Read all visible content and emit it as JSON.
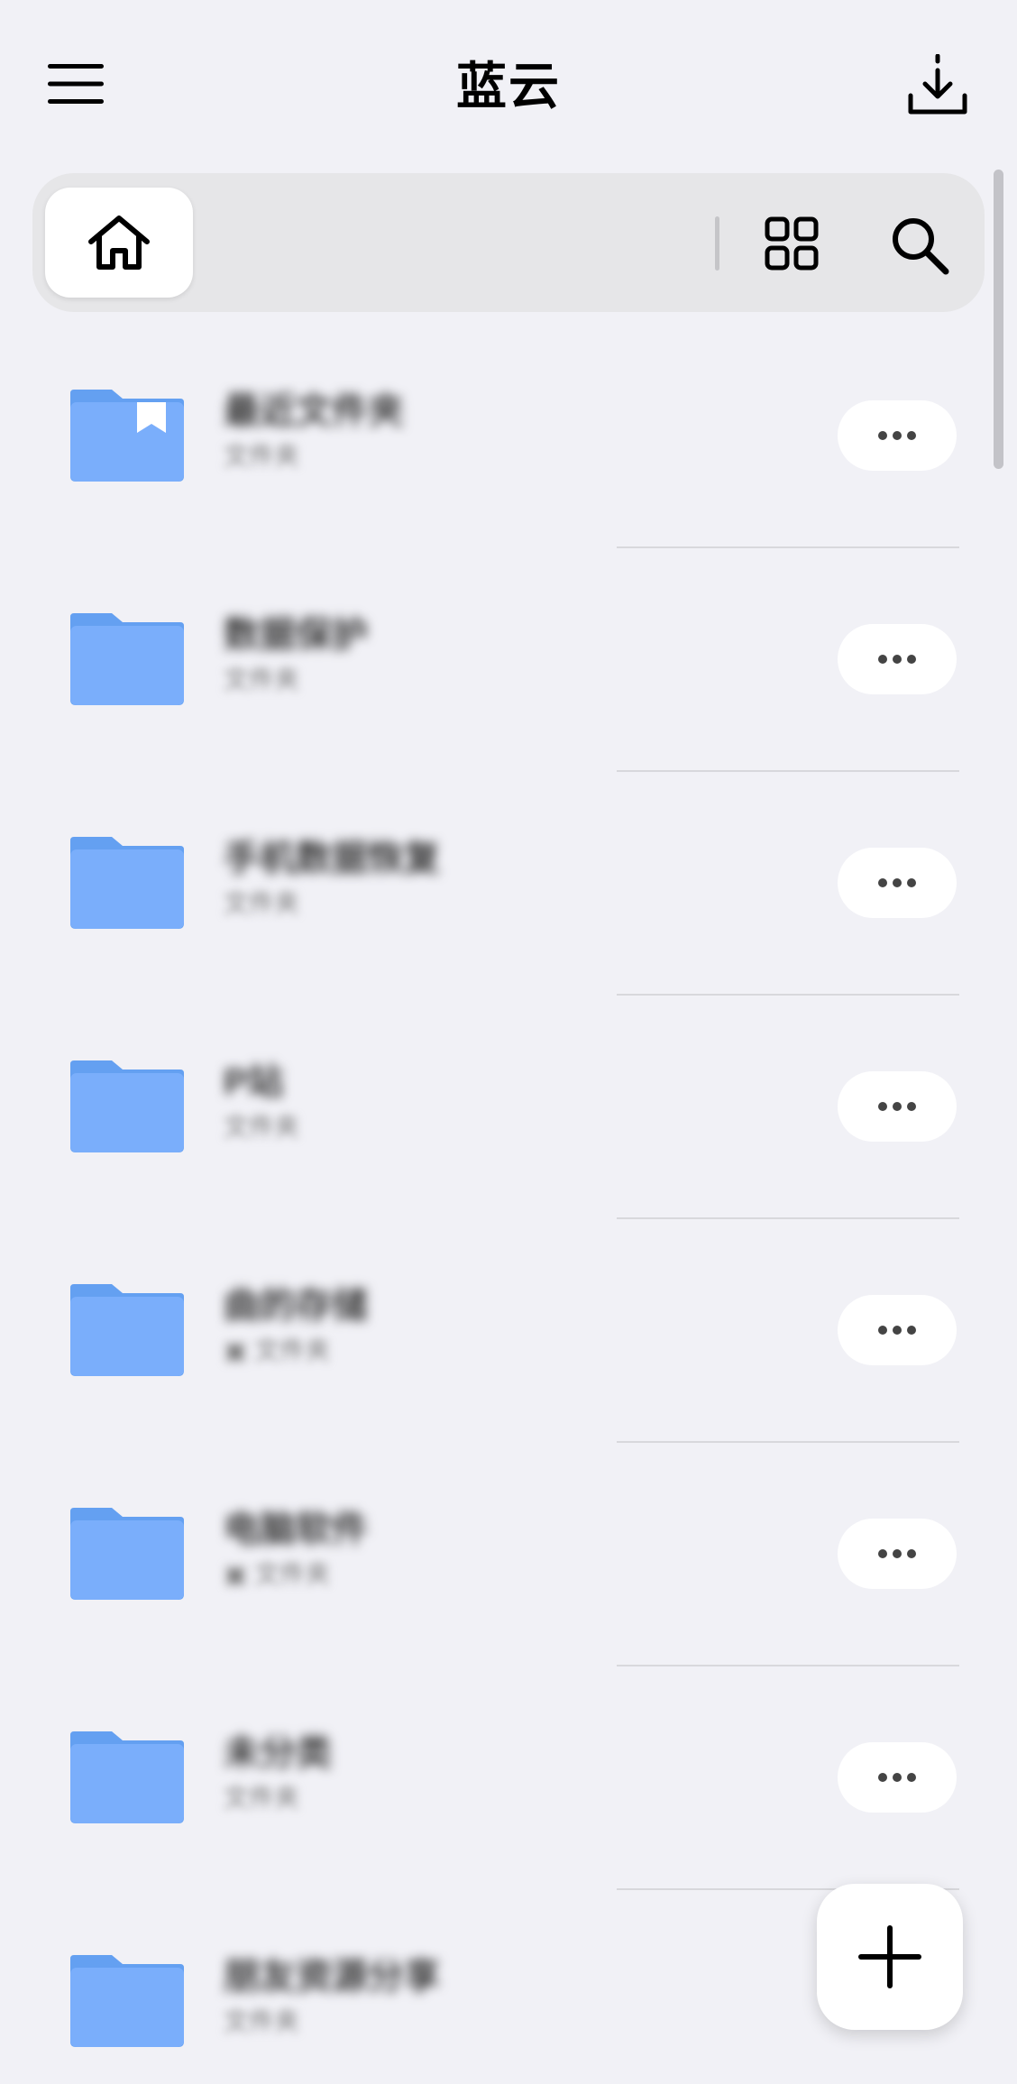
{
  "app": {
    "title": "蓝云"
  },
  "header": {
    "menu_icon": "hamburger-menu-icon",
    "download_icon": "download-icon"
  },
  "toolbar": {
    "home_icon": "home-icon",
    "view_icon": "grid-view-icon",
    "search_icon": "search-icon"
  },
  "files": [
    {
      "name": "最近文件夹",
      "meta": "文件夹",
      "bookmarked": true
    },
    {
      "name": "数据保护",
      "meta": "文件夹",
      "bookmarked": false
    },
    {
      "name": "手机数据恢复",
      "meta": "文件夹",
      "bookmarked": false
    },
    {
      "name": "P站",
      "meta": "文件夹",
      "bookmarked": false
    },
    {
      "name": "曲的存储",
      "meta": "▣ 文件夹",
      "bookmarked": false
    },
    {
      "name": "电脑软件",
      "meta": "▣ 文件夹",
      "bookmarked": false
    },
    {
      "name": "未分类",
      "meta": "文件夹",
      "bookmarked": false
    },
    {
      "name": "朋友资源分享",
      "meta": "文件夹",
      "bookmarked": false
    }
  ],
  "more_icon": "more-options-icon",
  "fab": {
    "icon": "plus-icon"
  },
  "colors": {
    "background": "#f1f1f6",
    "toolbar": "#e6e6e8",
    "folder": "#7aaefb",
    "folder_tab": "#64a0f1"
  }
}
